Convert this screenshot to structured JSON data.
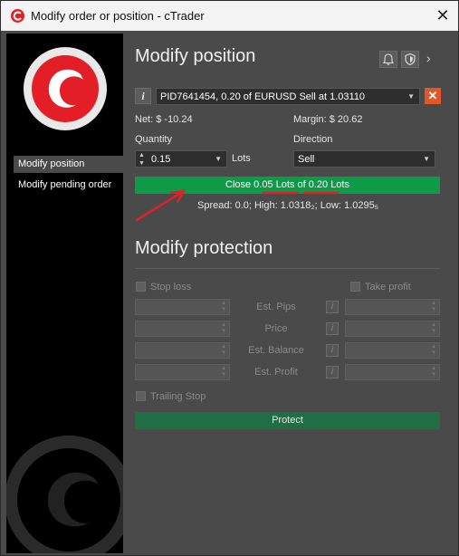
{
  "window": {
    "title": "Modify order or position - cTrader",
    "close_glyph": "✕"
  },
  "sidebar": {
    "items": [
      {
        "label": "Modify position",
        "active": true
      },
      {
        "label": "Modify pending order",
        "active": false
      }
    ]
  },
  "position": {
    "heading": "Modify position",
    "selected_position": "PID7641454, 0.20 of EURUSD Sell at 1.03110",
    "net": "Net: $ -10.24",
    "margin": "Margin: $ 20.62",
    "quantity_label": "Quantity",
    "quantity_value": "0.15",
    "quantity_unit": "Lots",
    "direction_label": "Direction",
    "direction_value": "Sell",
    "close_button": "Close 0.05 Lots of 0.20 Lots",
    "market_info": "Spread: 0.0; High: 1.0318₂; Low: 1.0295₅"
  },
  "protection": {
    "heading": "Modify protection",
    "stop_loss": "Stop loss",
    "take_profit": "Take profit",
    "rows": [
      "Est. Pips",
      "Price",
      "Est. Balance",
      "Est. Profit"
    ],
    "trailing_stop": "Trailing Stop",
    "protect_button": "Protect"
  },
  "colors": {
    "accent_green": "#0f9a48",
    "protect_green": "#1f6e44",
    "close_orange": "#e2572a",
    "brand_red": "#e41e26",
    "annotation_red": "#e0202a"
  },
  "icons": [
    "ctrader-logo-icon",
    "close-icon",
    "bell-icon",
    "shield-icon",
    "chevron-right-icon",
    "info-icon",
    "dropdown-arrow-icon",
    "spinner-icon"
  ]
}
